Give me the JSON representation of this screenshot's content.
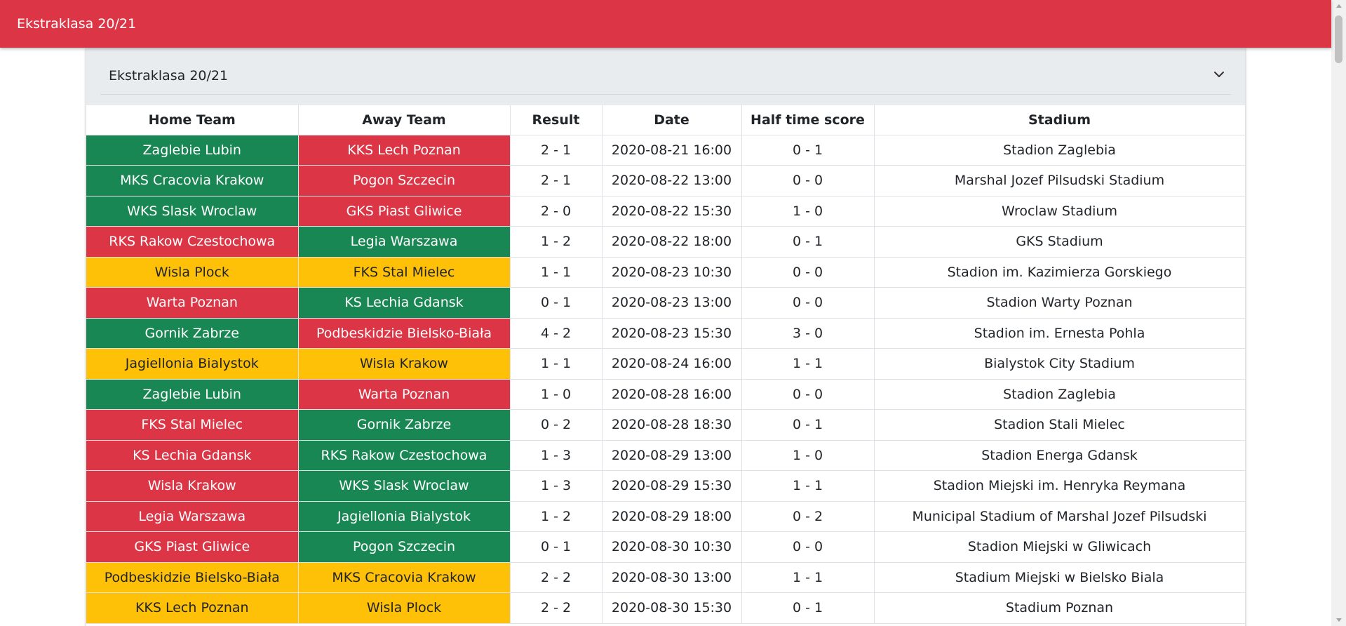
{
  "app": {
    "title": "Ekstraklasa 20/21"
  },
  "card": {
    "title": "Ekstraklasa 20/21"
  },
  "table": {
    "headers": [
      "Home Team",
      "Away Team",
      "Result",
      "Date",
      "Half time score",
      "Stadium"
    ],
    "rows": [
      {
        "home": "Zaglebie Lubin",
        "away": "KKS Lech Poznan",
        "result": "2 - 1",
        "date": "2020-08-21 16:00",
        "half": "0 - 1",
        "stadium": "Stadion Zaglebia",
        "home_status": "win",
        "away_status": "loss"
      },
      {
        "home": "MKS Cracovia Krakow",
        "away": "Pogon Szczecin",
        "result": "2 - 1",
        "date": "2020-08-22 13:00",
        "half": "0 - 0",
        "stadium": "Marshal Jozef Pilsudski Stadium",
        "home_status": "win",
        "away_status": "loss"
      },
      {
        "home": "WKS Slask Wroclaw",
        "away": "GKS Piast Gliwice",
        "result": "2 - 0",
        "date": "2020-08-22 15:30",
        "half": "1 - 0",
        "stadium": "Wroclaw Stadium",
        "home_status": "win",
        "away_status": "loss"
      },
      {
        "home": "RKS Rakow Czestochowa",
        "away": "Legia Warszawa",
        "result": "1 - 2",
        "date": "2020-08-22 18:00",
        "half": "0 - 1",
        "stadium": "GKS Stadium",
        "home_status": "loss",
        "away_status": "win"
      },
      {
        "home": "Wisla Plock",
        "away": "FKS Stal Mielec",
        "result": "1 - 1",
        "date": "2020-08-23 10:30",
        "half": "0 - 0",
        "stadium": "Stadion im. Kazimierza Gorskiego",
        "home_status": "draw",
        "away_status": "draw"
      },
      {
        "home": "Warta Poznan",
        "away": "KS Lechia Gdansk",
        "result": "0 - 1",
        "date": "2020-08-23 13:00",
        "half": "0 - 0",
        "stadium": "Stadion Warty Poznan",
        "home_status": "loss",
        "away_status": "win"
      },
      {
        "home": "Gornik Zabrze",
        "away": "Podbeskidzie Bielsko-Biała",
        "result": "4 - 2",
        "date": "2020-08-23 15:30",
        "half": "3 - 0",
        "stadium": "Stadion im. Ernesta Pohla",
        "home_status": "win",
        "away_status": "loss"
      },
      {
        "home": "Jagiellonia Bialystok",
        "away": "Wisla Krakow",
        "result": "1 - 1",
        "date": "2020-08-24 16:00",
        "half": "1 - 1",
        "stadium": "Bialystok City Stadium",
        "home_status": "draw",
        "away_status": "draw"
      },
      {
        "home": "Zaglebie Lubin",
        "away": "Warta Poznan",
        "result": "1 - 0",
        "date": "2020-08-28 16:00",
        "half": "0 - 0",
        "stadium": "Stadion Zaglebia",
        "home_status": "win",
        "away_status": "loss"
      },
      {
        "home": "FKS Stal Mielec",
        "away": "Gornik Zabrze",
        "result": "0 - 2",
        "date": "2020-08-28 18:30",
        "half": "0 - 1",
        "stadium": "Stadion Stali Mielec",
        "home_status": "loss",
        "away_status": "win"
      },
      {
        "home": "KS Lechia Gdansk",
        "away": "RKS Rakow Czestochowa",
        "result": "1 - 3",
        "date": "2020-08-29 13:00",
        "half": "1 - 0",
        "stadium": "Stadion Energa Gdansk",
        "home_status": "loss",
        "away_status": "win"
      },
      {
        "home": "Wisla Krakow",
        "away": "WKS Slask Wroclaw",
        "result": "1 - 3",
        "date": "2020-08-29 15:30",
        "half": "1 - 1",
        "stadium": "Stadion Miejski im. Henryka Reymana",
        "home_status": "loss",
        "away_status": "win"
      },
      {
        "home": "Legia Warszawa",
        "away": "Jagiellonia Bialystok",
        "result": "1 - 2",
        "date": "2020-08-29 18:00",
        "half": "0 - 2",
        "stadium": "Municipal Stadium of Marshal Jozef Pilsudski",
        "home_status": "loss",
        "away_status": "win"
      },
      {
        "home": "GKS Piast Gliwice",
        "away": "Pogon Szczecin",
        "result": "0 - 1",
        "date": "2020-08-30 10:30",
        "half": "0 - 0",
        "stadium": "Stadion Miejski w Gliwicach",
        "home_status": "loss",
        "away_status": "win"
      },
      {
        "home": "Podbeskidzie Bielsko-Biała",
        "away": "MKS Cracovia Krakow",
        "result": "2 - 2",
        "date": "2020-08-30 13:00",
        "half": "1 - 1",
        "stadium": "Stadium Miejski w Bielsko Biala",
        "home_status": "draw",
        "away_status": "draw"
      },
      {
        "home": "KKS Lech Poznan",
        "away": "Wisla Plock",
        "result": "2 - 2",
        "date": "2020-08-30 15:30",
        "half": "0 - 1",
        "stadium": "Stadium Poznan",
        "home_status": "draw",
        "away_status": "draw"
      }
    ]
  },
  "colors": {
    "brand": "#dc3545",
    "win": "#198754",
    "loss": "#dc3545",
    "draw": "#ffc107"
  },
  "icons": {
    "collapse": "chevron-down-icon"
  }
}
